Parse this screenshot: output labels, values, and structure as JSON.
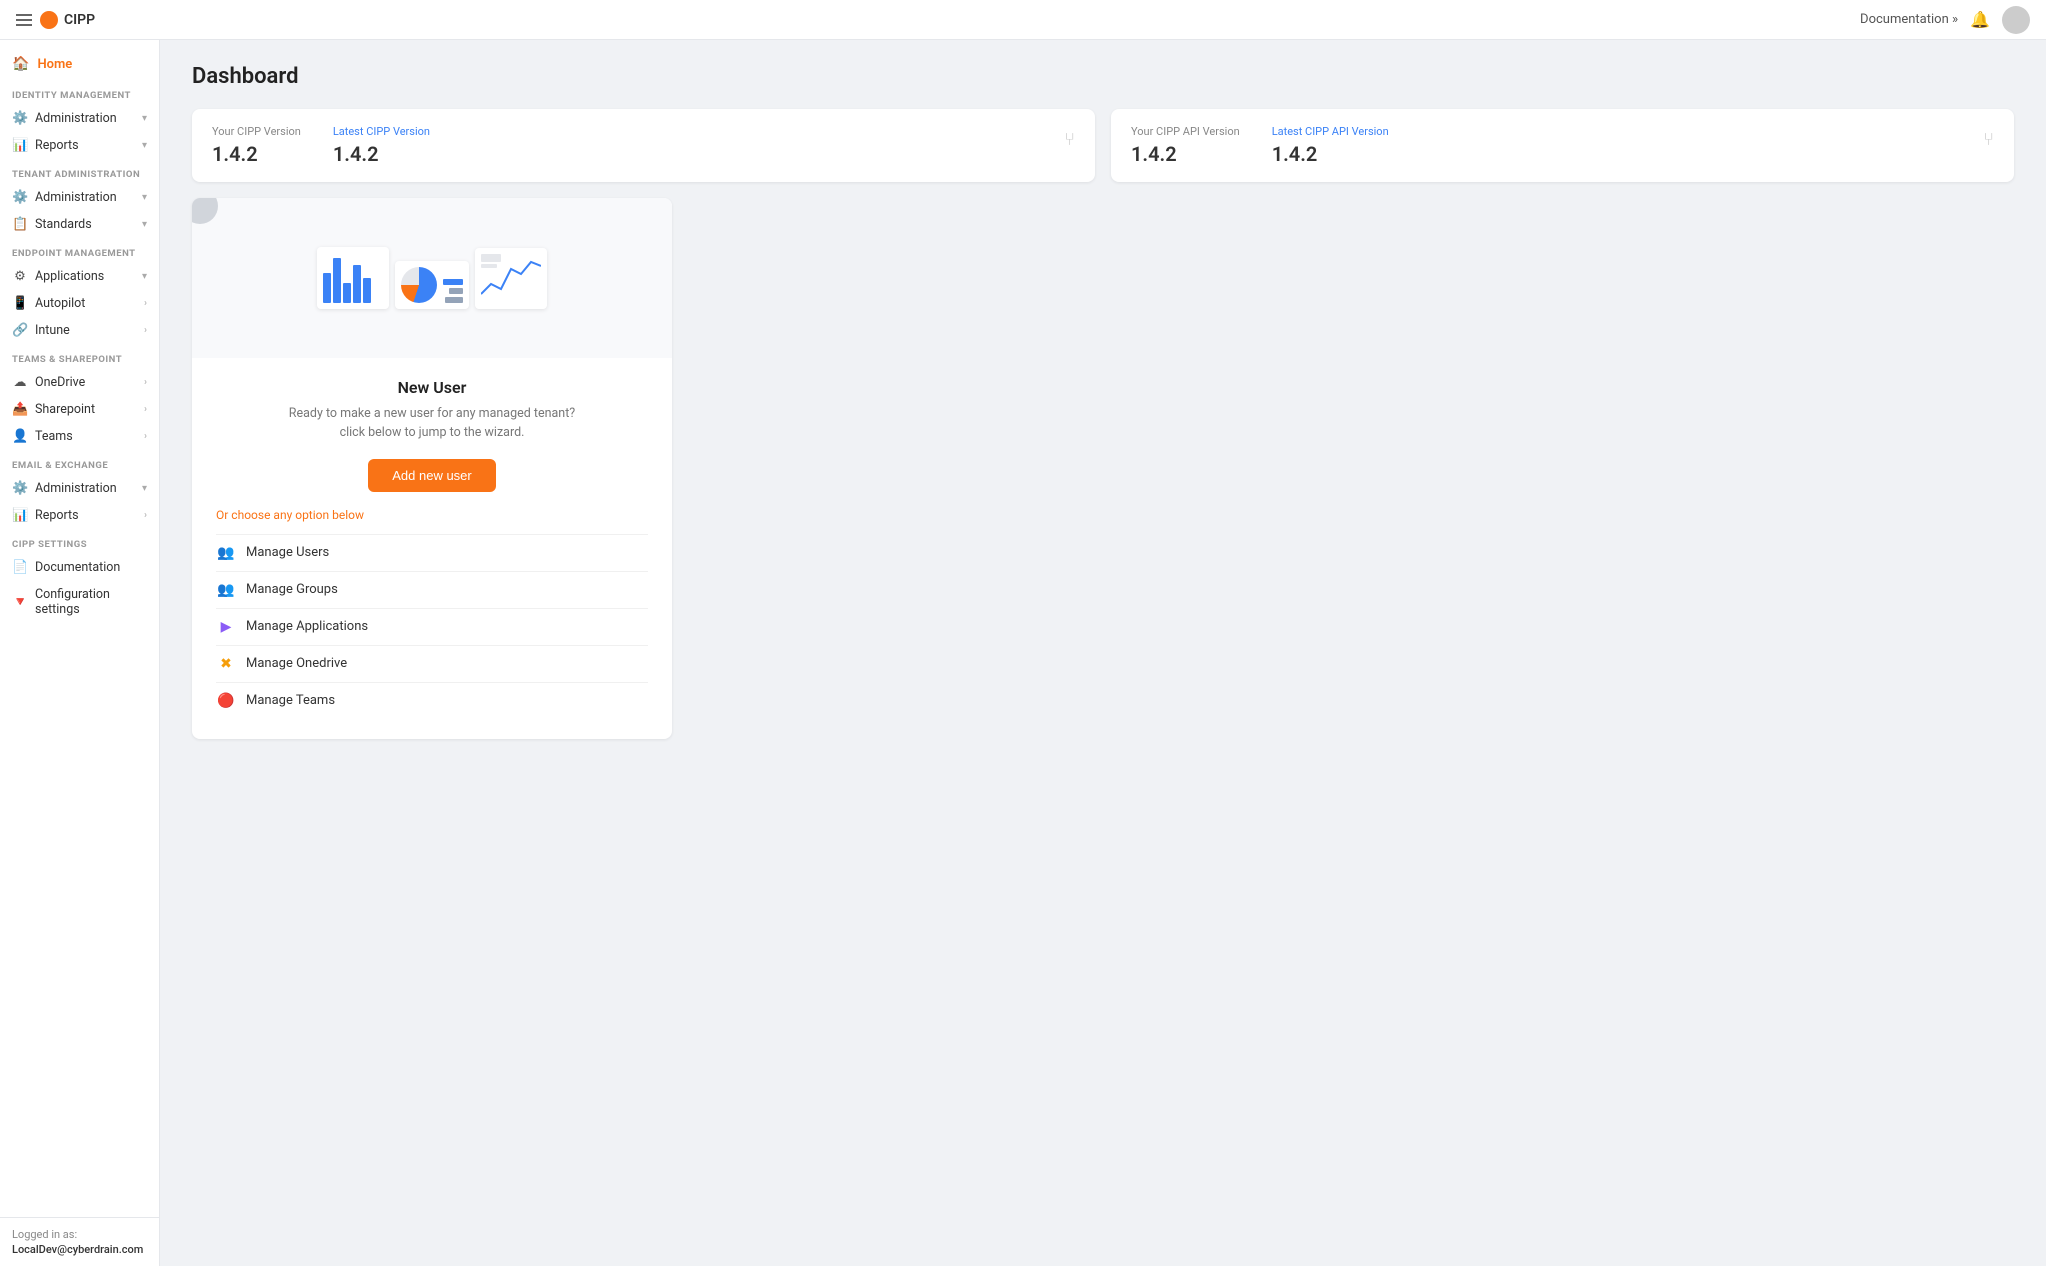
{
  "topNav": {
    "brand": "CIPP",
    "docLink": "Documentation »",
    "hamburger": "menu"
  },
  "sidebar": {
    "homeLabel": "Home",
    "sections": [
      {
        "label": "IDENTITY MANAGEMENT",
        "items": [
          {
            "label": "Administration",
            "icon": "⚙",
            "hasChevron": true
          },
          {
            "label": "Reports",
            "icon": "📊",
            "hasChevron": true
          }
        ]
      },
      {
        "label": "TENANT ADMINISTRATION",
        "items": [
          {
            "label": "Administration",
            "icon": "⚙",
            "hasChevron": true
          },
          {
            "label": "Standards",
            "icon": "📋",
            "hasChevron": true
          }
        ]
      },
      {
        "label": "ENDPOINT MANAGEMENT",
        "items": [
          {
            "label": "Applications",
            "icon": "🔧",
            "hasChevron": true
          },
          {
            "label": "Autopilot",
            "icon": "📱",
            "hasChevron": true
          },
          {
            "label": "Intune",
            "icon": "🔗",
            "hasChevron": true
          }
        ]
      },
      {
        "label": "TEAMS & SHAREPOINT",
        "items": [
          {
            "label": "OneDrive",
            "icon": "☁",
            "hasChevron": true
          },
          {
            "label": "Sharepoint",
            "icon": "📤",
            "hasChevron": true
          },
          {
            "label": "Teams",
            "icon": "👤",
            "hasChevron": true
          }
        ]
      },
      {
        "label": "EMAIL & EXCHANGE",
        "items": [
          {
            "label": "Administration",
            "icon": "⚙",
            "hasChevron": true
          },
          {
            "label": "Reports",
            "icon": "📊",
            "hasChevron": true
          }
        ]
      },
      {
        "label": "CIPP SETTINGS",
        "items": [
          {
            "label": "Documentation",
            "icon": "📄",
            "hasChevron": false
          },
          {
            "label": "Configuration settings",
            "icon": "🔺",
            "hasChevron": false
          }
        ]
      }
    ],
    "footer": {
      "loggedInAs": "Logged in as:",
      "email": "LocalDev@cyberdrain.com"
    }
  },
  "main": {
    "pageTitle": "Dashboard",
    "versionCard1": {
      "label1": "Your CIPP Version",
      "value1": "1.4.2",
      "label2": "Latest CIPP Version",
      "value2": "1.4.2"
    },
    "versionCard2": {
      "label1": "Your CIPP API Version",
      "value1": "1.4.2",
      "label2": "Latest CIPP API Version",
      "value2": "1.4.2"
    },
    "dashCard": {
      "title": "New User",
      "subtitle": "Ready to make a new user for any managed tenant?\nclick below to jump to the wizard.",
      "btnLabel": "Add new user",
      "orChoose": "Or choose any option below",
      "options": [
        {
          "label": "Manage Users",
          "iconClass": "blue",
          "icon": "👥"
        },
        {
          "label": "Manage Groups",
          "iconClass": "green",
          "icon": "👥"
        },
        {
          "label": "Manage Applications",
          "iconClass": "purple",
          "icon": "▶"
        },
        {
          "label": "Manage Onedrive",
          "iconClass": "yellow",
          "icon": "✖"
        },
        {
          "label": "Manage Teams",
          "iconClass": "red",
          "icon": "🔴"
        }
      ]
    }
  }
}
